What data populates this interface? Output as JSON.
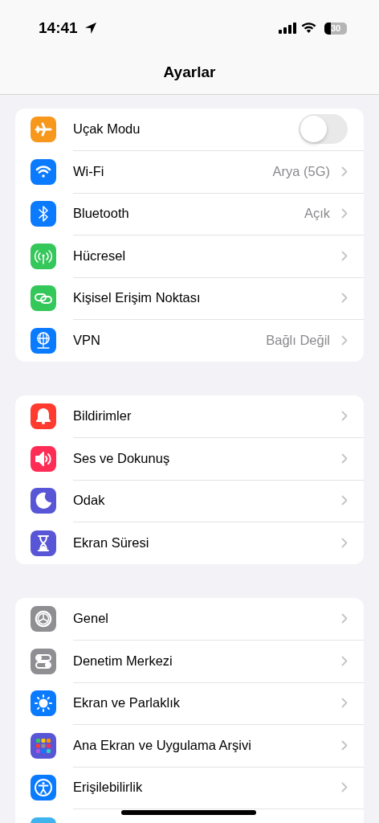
{
  "status_bar": {
    "time": "14:41",
    "battery": "30"
  },
  "title": "Ayarlar",
  "groups": [
    {
      "items": [
        {
          "kind": "toggle",
          "label": "Uçak Modu",
          "color": "#f7981c",
          "on": false
        },
        {
          "kind": "link",
          "label": "Wi-Fi",
          "color": "#0a7aff",
          "value": "Arya (5G)"
        },
        {
          "kind": "link",
          "label": "Bluetooth",
          "color": "#0a7aff",
          "value": "Açık"
        },
        {
          "kind": "link",
          "label": "Hücresel",
          "color": "#34c759"
        },
        {
          "kind": "link",
          "label": "Kişisel Erişim Noktası",
          "color": "#34c759"
        },
        {
          "kind": "link",
          "label": "VPN",
          "color": "#0a7aff",
          "value": "Bağlı Değil"
        }
      ]
    },
    {
      "items": [
        {
          "kind": "link",
          "label": "Bildirimler",
          "color": "#ff3b30"
        },
        {
          "kind": "link",
          "label": "Ses ve Dokunuş",
          "color": "#ff2d55"
        },
        {
          "kind": "link",
          "label": "Odak",
          "color": "#5856d6"
        },
        {
          "kind": "link",
          "label": "Ekran Süresi",
          "color": "#5856d6"
        }
      ]
    },
    {
      "items": [
        {
          "kind": "link",
          "label": "Genel",
          "color": "#8e8e93"
        },
        {
          "kind": "link",
          "label": "Denetim Merkezi",
          "color": "#8e8e93"
        },
        {
          "kind": "link",
          "label": "Ekran ve Parlaklık",
          "color": "#0a7aff"
        },
        {
          "kind": "link",
          "label": "Ana Ekran ve Uygulama Arşivi",
          "color": "#5856d6"
        },
        {
          "kind": "link",
          "label": "Erişilebilirlik",
          "color": "#0a7aff"
        },
        {
          "kind": "link",
          "color": "#3fb3ee"
        }
      ]
    }
  ]
}
